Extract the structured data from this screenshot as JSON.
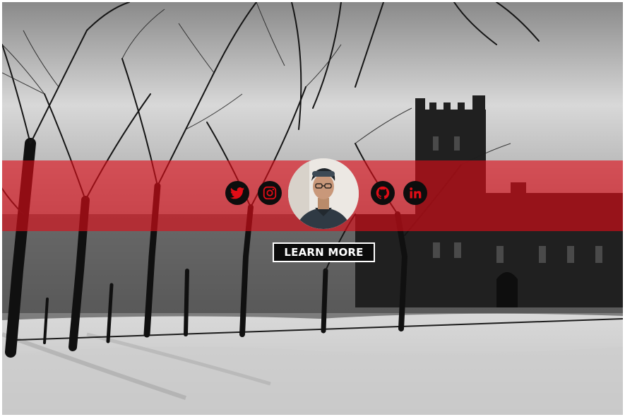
{
  "hero": {
    "button_label": "LEARN MORE",
    "overlay_color": "#e10c16"
  },
  "social_links": [
    {
      "name": "twitter",
      "icon": "twitter-icon"
    },
    {
      "name": "instagram",
      "icon": "instagram-icon"
    },
    {
      "name": "github",
      "icon": "github-icon"
    },
    {
      "name": "linkedin",
      "icon": "linkedin-icon"
    }
  ],
  "profile": {
    "avatar": "avatar-photo"
  }
}
